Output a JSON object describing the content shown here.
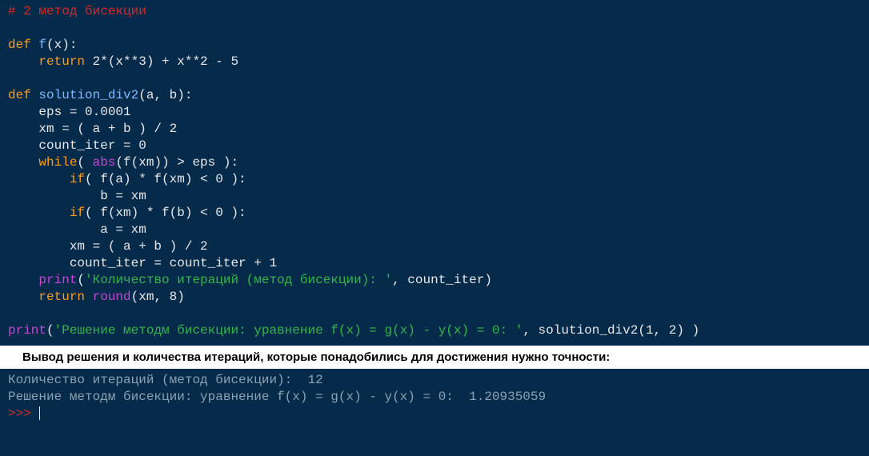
{
  "code": {
    "comment": "# 2 метод бисекции",
    "def": "def",
    "f_name": "f",
    "f_args": "(x):",
    "return": "return",
    "f_body": " 2*(x**3) + x**2 - 5",
    "sol_name": "solution_div2",
    "sol_args": "(a, b):",
    "line_eps": "    eps = 0.0001",
    "line_xm": "    xm = ( a + b ) / 2",
    "line_ci": "    count_iter = 0",
    "while": "while",
    "abs": "abs",
    "while_pre": "( ",
    "while_mid": "(f(xm)) > eps ):",
    "if": "if",
    "if1_cond": "( f(a) * f(xm) < 0 ):",
    "if1_body": "            b = xm",
    "if2_cond": "( f(xm) * f(b) < 0 ):",
    "if2_body": "            a = xm",
    "line_xm2": "        xm = ( a + b ) / 2",
    "line_cip": "        count_iter = count_iter + 1",
    "print": "print",
    "print1_str": "'Количество итераций (метод бисекции): '",
    "print1_tail": ", count_iter)",
    "round": "round",
    "return2_tail": "(xm, 8)",
    "print2_str": "'Решение методм бисекции: уравнение f(x) = g(x) - y(x) = 0: '",
    "print2_tail": ", solution_div2(1, 2) )"
  },
  "label": "Вывод решения и количества итераций, которые понадобились для достижения нужно точности:",
  "output": {
    "line1": "Количество итераций (метод бисекции):  12",
    "line2": "Решение методм бисекции: уравнение f(x) = g(x) - y(x) = 0:  1.20935059",
    "prompt": ">>> "
  }
}
